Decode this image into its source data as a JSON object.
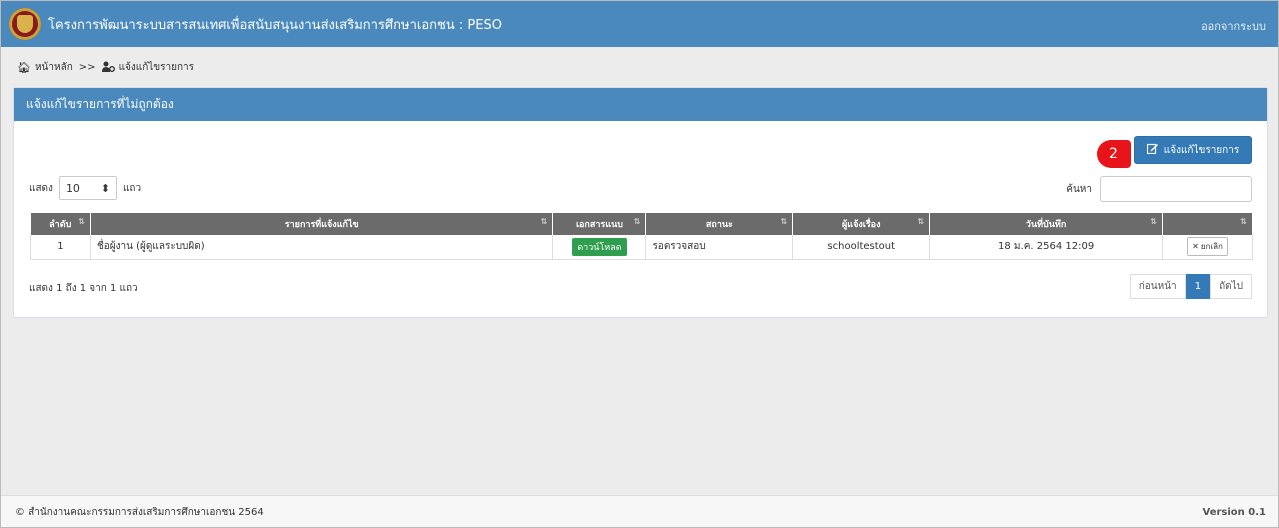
{
  "app": {
    "title": "โครงการพัฒนาระบบสารสนเทศเพื่อสนับสนุนงานส่งเสริมการศึกษาเอกชน : PESO",
    "logout_label": "ออกจากระบบ"
  },
  "breadcrumb": {
    "home_label": "หน้าหลัก",
    "separator": ">>",
    "current_label": "แจ้งแก้ไขรายการ"
  },
  "panel": {
    "title": "แจ้งแก้ไขรายการที่ไม่ถูกต้อง",
    "add_button_label": "แจ้งแก้ไขรายการ",
    "marker_number": "2"
  },
  "length": {
    "prefix": "แสดง",
    "value": "10",
    "suffix": "แถว"
  },
  "search": {
    "label": "ค้นหา",
    "value": ""
  },
  "table": {
    "headers": [
      "ลำดับ",
      "รายการที่แจ้งแก้ไข",
      "เอกสารแนบ",
      "สถานะ",
      "ผู้แจ้งเรื่อง",
      "วันที่บันทึก",
      ""
    ],
    "rows": [
      {
        "no": "1",
        "item": "ชื่อผู้งาน (ผู้ดูแลระบบผิด)",
        "attachment": "ดาวน์โหลด",
        "status": "รอตรวจสอบ",
        "reporter": "schooltestout",
        "date": "18 ม.ค. 2564 12:09",
        "action": "ยกเลิก"
      }
    ]
  },
  "info": "แสดง 1 ถึง 1 จาก 1 แถว",
  "pagination": {
    "prev_label": "ก่อนหน้า",
    "current_page": "1",
    "next_label": "ถัดไป"
  },
  "footer": {
    "copyright": "© สำนักงานคณะกรรมการส่งเสริมการศึกษาเอกชน 2564",
    "version": "Version 0.1"
  },
  "colors": {
    "navbar": "#4a89be",
    "primary_button": "#337ab7",
    "table_header": "#6b6b6b",
    "download_badge": "#2f9e4f",
    "marker": "#e8141a"
  }
}
